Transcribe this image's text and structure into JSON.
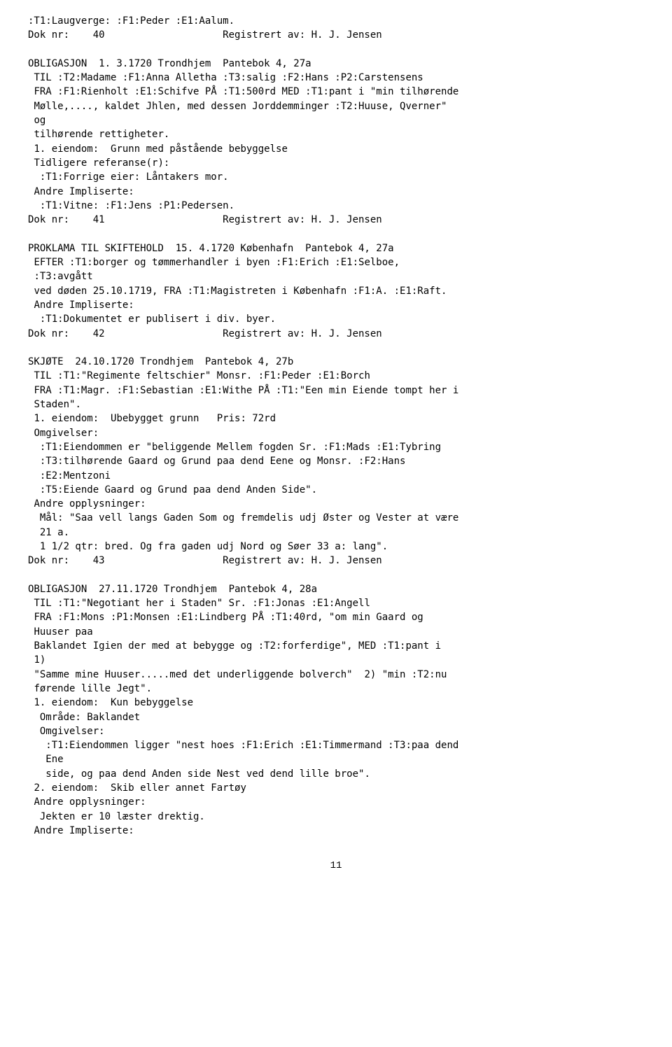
{
  "page": {
    "number": "11",
    "content": ":T1:Laugverge: :F1:Peder :E1:Aalum.\nDok nr:    40                    Registrert av: H. J. Jensen\n\nOBLIGASJON  1. 3.1720 Trondhjem  Pantebok 4, 27a\n TIL :T2:Madame :F1:Anna Alletha :T3:salig :F2:Hans :P2:Carstensens\n FRA :F1:Rienholt :E1:Schifve PÅ :T1:500rd MED :T1:pant i \"min tilhørende\n Mølle,...., kaldet Jhlen, med dessen Jorddemminger :T2:Huuse, Qverner\"\n og\n tilhørende rettigheter.\n 1. eiendom:  Grunn med påstående bebyggelse\n Tidligere referanse(r):\n  :T1:Forrige eier: Låntakers mor.\n Andre Impliserte:\n  :T1:Vitne: :F1:Jens :P1:Pedersen.\nDok nr:    41                    Registrert av: H. J. Jensen\n\nPROKLAMA TIL SKIFTEHOLD  15. 4.1720 Københafn  Pantebok 4, 27a\n EFTER :T1:borger og tømmerhandler i byen :F1:Erich :E1:Selboe,\n :T3:avgått\n ved døden 25.10.1719, FRA :T1:Magistreten i Københafn :F1:A. :E1:Raft.\n Andre Impliserte:\n  :T1:Dokumentet er publisert i div. byer.\nDok nr:    42                    Registrert av: H. J. Jensen\n\nSKJØTE  24.10.1720 Trondhjem  Pantebok 4, 27b\n TIL :T1:\"Regimente feltschier\" Monsr. :F1:Peder :E1:Borch\n FRA :T1:Magr. :F1:Sebastian :E1:Withe PÅ :T1:\"Een min Eiende tompt her i\n Staden\".\n 1. eiendom:  Ubebygget grunn   Pris: 72rd\n Omgivelser:\n  :T1:Eiendommen er \"beliggende Mellem fogden Sr. :F1:Mads :E1:Tybring\n  :T3:tilhørende Gaard og Grund paa dend Eene og Monsr. :F2:Hans\n  :E2:Mentzoni\n  :T5:Eiende Gaard og Grund paa dend Anden Side\".\n Andre opplysninger:\n  Mål: \"Saa vell langs Gaden Som og fremdelis udj Øster og Vester at være\n  21 a.\n  1 1/2 qtr: bred. Og fra gaden udj Nord og Søer 33 a: lang\".\nDok nr:    43                    Registrert av: H. J. Jensen\n\nOBLIGASJON  27.11.1720 Trondhjem  Pantebok 4, 28a\n TIL :T1:\"Negotiant her i Staden\" Sr. :F1:Jonas :E1:Angell\n FRA :F1:Mons :P1:Monsen :E1:Lindberg PÅ :T1:40rd, \"om min Gaard og\n Huuser paa\n Baklandet Igien der med at bebygge og :T2:forferdige\", MED :T1:pant i\n 1)\n \"Samme mine Huuser.....med det underliggende bolverch\"  2) \"min :T2:nu\n førende lille Jegt\".\n 1. eiendom:  Kun bebyggelse\n  Område: Baklandet\n  Omgivelser:\n   :T1:Eiendommen ligger \"nest hoes :F1:Erich :E1:Timmermand :T3:paa dend\n   Ene\n   side, og paa dend Anden side Nest ved dend lille broe\".\n 2. eiendom:  Skib eller annet Fartøy\n Andre opplysninger:\n  Jekten er 10 læster drektig.\n Andre Impliserte:"
  }
}
